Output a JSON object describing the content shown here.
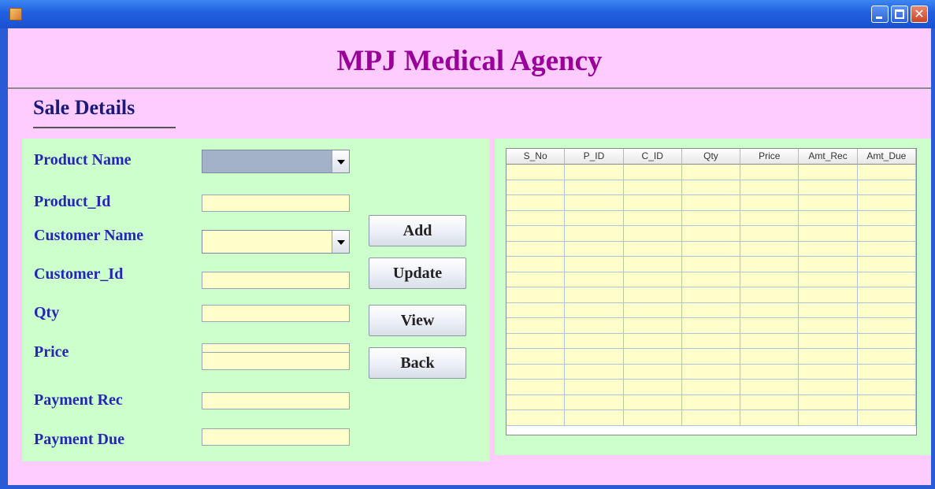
{
  "window": {
    "icon": "java-cup-icon",
    "controls": [
      "minimize-icon",
      "maximize-icon",
      "close-icon"
    ]
  },
  "header": {
    "title": "MPJ Medical Agency"
  },
  "section": {
    "title": "Sale Details"
  },
  "form": {
    "product_name_label": "Product Name",
    "product_name_value": "",
    "product_id_label": "Product_Id",
    "product_id_value": "",
    "customer_name_label": "Customer Name",
    "customer_name_value": "",
    "customer_id_label": "Customer_Id",
    "customer_id_value": "",
    "qty_label": "Qty",
    "qty_value": "",
    "price_label": "Price",
    "price_value": "",
    "payment_rec_label": "Payment Rec",
    "payment_rec_value": "",
    "payment_due_label": "Payment Due",
    "payment_due_value": ""
  },
  "buttons": {
    "add": "Add",
    "update": "Update",
    "view": "View",
    "back": "Back"
  },
  "table": {
    "columns": [
      "S_No",
      "P_ID",
      "C_ID",
      "Qty",
      "Price",
      "Amt_Rec",
      "Amt_Due"
    ],
    "empty_rows": 17
  },
  "colors": {
    "background": "#ffccff",
    "form_panel": "#ccffcc",
    "field": "#ffffcc",
    "title": "#990099",
    "label": "#2626b4",
    "product_combo": "#a4b2c8"
  }
}
